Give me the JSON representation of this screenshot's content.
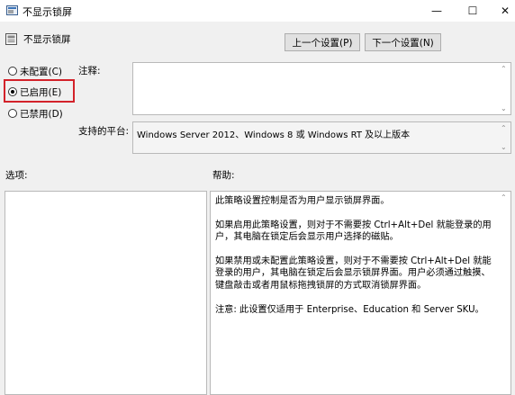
{
  "window": {
    "title": "不显示锁屏"
  },
  "header": {
    "policy_name": "不显示锁屏",
    "prev_button": "上一个设置(P)",
    "next_button": "下一个设置(N)"
  },
  "options": [
    {
      "label": "未配置(C)",
      "checked": false
    },
    {
      "label": "已启用(E)",
      "checked": true
    },
    {
      "label": "已禁用(D)",
      "checked": false
    }
  ],
  "comment": {
    "label": "注释:",
    "value": ""
  },
  "platform": {
    "label": "支持的平台:",
    "value": "Windows Server 2012、Windows 8 或 Windows RT 及以上版本"
  },
  "options_panel": {
    "label": "选项:"
  },
  "help_panel": {
    "label": "帮助:",
    "paragraphs": [
      "此策略设置控制是否为用户显示锁屏界面。",
      "如果启用此策略设置，则对于不需要按 Ctrl+Alt+Del 就能登录的用户，其电脑在锁定后会显示用户选择的磁贴。",
      "如果禁用或未配置此策略设置，则对于不需要按 Ctrl+Alt+Del 就能登录的用户，其电脑在锁定后会显示锁屏界面。用户必须通过触摸、键盘敲击或者用鼠标拖拽锁屏的方式取消锁屏界面。",
      "注意: 此设置仅适用于 Enterprise、Education 和 Server SKU。"
    ]
  },
  "colors": {
    "highlight": "#d3222a"
  }
}
